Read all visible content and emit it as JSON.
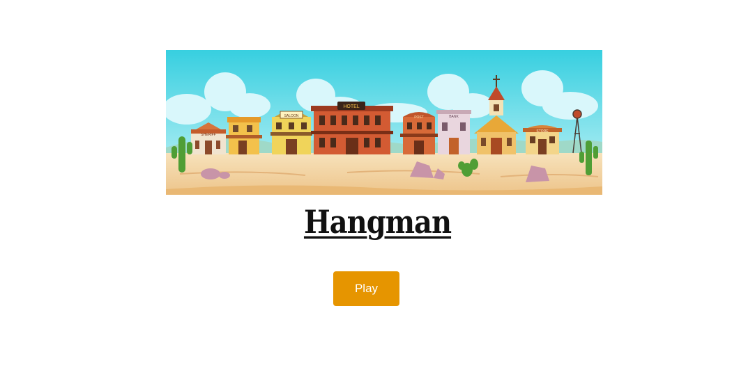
{
  "banner": {
    "image_name": "wild-west-town-illustration",
    "signs": {
      "sheriff": "SHERIFF",
      "saloon": "SALOON",
      "hotel": "HOTEL",
      "post": "POST",
      "bank": "BANK",
      "store": "STORE"
    }
  },
  "title": "Hangman",
  "play_button": {
    "label": "Play",
    "color": "#e69500"
  },
  "colors": {
    "sky": "#46d2e3",
    "sand": "#f3d7a8",
    "cactus": "#5aa83a"
  }
}
